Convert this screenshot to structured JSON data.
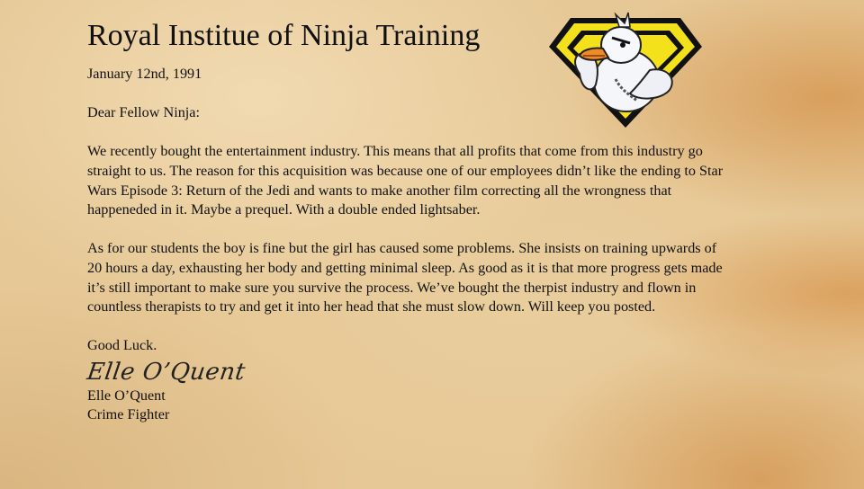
{
  "letter": {
    "title": "Royal Institue of Ninja Training",
    "date": "January 12nd, 1991",
    "salutation": "Dear Fellow Ninja:",
    "paragraphs": [
      "We recently bought the entertainment industry. This means that all profits that come from this industry go straight to us. The reason for this acquisition was because one of our employees didn’t like the ending to Star Wars Episode 3: Return of the Jedi and wants to make another film correcting all the wrongness that happeneded in it. Maybe a prequel. With a double ended lightsaber.",
      "As for our students the boy is fine but the girl has caused some problems. She insists on training upwards of 20 hours a day, exhausting her body and getting minimal sleep. As good as it is that more progress gets made it’s still important to make sure you survive the process. We’ve bought the therpist industry and flown in countless therapists to try and get it into her head that she must slow down. Will keep you posted."
    ],
    "closing": "Good Luck.",
    "signature": "Elle O’Quent",
    "signer_name": "Elle O’Quent",
    "signer_title": "Crime Fighter"
  },
  "logo": {
    "icon": "muscular-duck-superhero-badge-icon",
    "colors": {
      "shield_yellow": "#f3e11c",
      "shield_outline": "#111111",
      "duck_white": "#f4f6fa",
      "beak_orange": "#f08a24"
    }
  }
}
